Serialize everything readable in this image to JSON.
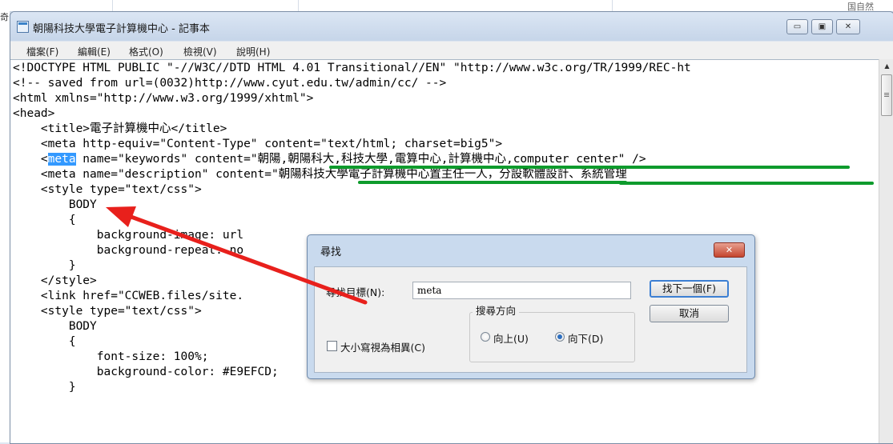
{
  "background": {
    "left_edge_glyph": "奇",
    "corner_text": "国自然"
  },
  "window": {
    "title": "朝陽科技大學電子計算機中心 - 記事本",
    "buttons": {
      "minimize": "▭",
      "maximize": "▣",
      "close": "✕"
    }
  },
  "menu": [
    "檔案(F)",
    "編輯(E)",
    "格式(O)",
    "檢視(V)",
    "說明(H)"
  ],
  "code": {
    "lines": [
      "<!DOCTYPE HTML PUBLIC \"-//W3C//DTD HTML 4.01 Transitional//EN\" \"http://www.w3c.org/TR/1999/REC-ht",
      "<!-- saved from url=(0032)http://www.cyut.edu.tw/admin/cc/ -->",
      "<html xmlns=\"http://www.w3.org/1999/xhtml\">",
      "<head>",
      "    <title>電子計算機中心</title>",
      "    <meta http-equiv=\"Content-Type\" content=\"text/html; charset=big5\">"
    ],
    "line7_prefix": "    <",
    "line7_highlight": "meta",
    "line7_suffix": " name=\"keywords\" content=\"朝陽,朝陽科大,科技大學,電算中心,計算機中心,computer center\" />",
    "line8": "    <meta name=\"description\" content=\"朝陽科技大學電子計算機中心置主任一人，分設軟體設計、系統管理",
    "line9": "    <style type=\"text/css\">",
    "line10": "        BODY",
    "line11": "        {",
    "line12": "            background-image: url",
    "line13": "            background-repeat: no",
    "line14": "        }",
    "line15": "    </style>",
    "line16": "    <link href=\"CCWEB.files/site.",
    "line17": "    <style type=\"text/css\">",
    "line18": "        BODY",
    "line19": "        {",
    "line20": "            font-size: 100%;",
    "line21": "            background-color: #E9EFCD;",
    "line22": "        }"
  },
  "find_dialog": {
    "title": "尋找",
    "close_label": "✕",
    "find_label": "尋找目標(N):",
    "find_value": "meta",
    "find_next_label": "找下一個(F)",
    "cancel_label": "取消",
    "direction_label": "搜尋方向",
    "up_label": "向上(U)",
    "down_label": "向下(D)",
    "direction_selected": "down",
    "match_case_label": "大小寫視為相異(C)",
    "match_case_checked": false
  },
  "annotations": {
    "arrow_color": "#e8201c",
    "underline_color": "#0e9b2c"
  }
}
